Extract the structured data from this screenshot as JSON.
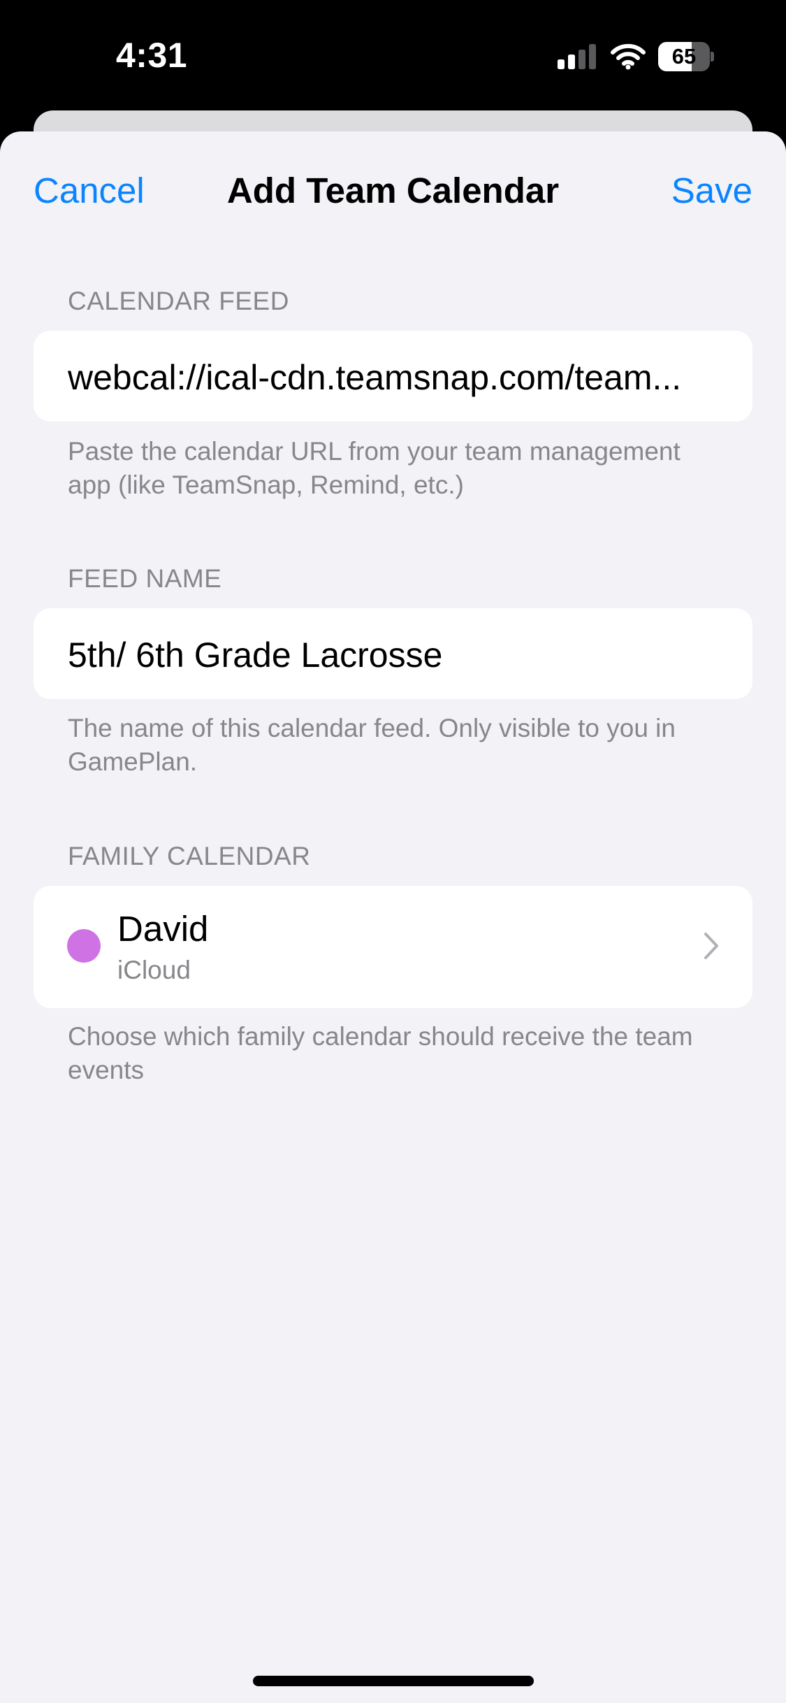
{
  "status_bar": {
    "time": "4:31",
    "battery_level": "65",
    "battery_fraction": 0.65,
    "signal_icon": "cellular-signal-icon",
    "wifi_icon": "wifi-icon"
  },
  "nav": {
    "cancel_label": "Cancel",
    "title": "Add Team Calendar",
    "save_label": "Save"
  },
  "calendar_feed": {
    "header": "CALENDAR FEED",
    "value": "webcal://ical-cdn.teamsnap.com/team...",
    "footer": "Paste the calendar URL from your team management app (like TeamSnap, Remind, etc.)"
  },
  "feed_name": {
    "header": "FEED NAME",
    "value": "5th/ 6th Grade Lacrosse",
    "footer": "The name of this calendar feed. Only visible to you in GamePlan."
  },
  "family_calendar": {
    "header": "FAMILY CALENDAR",
    "name": "David",
    "source": "iCloud",
    "color": "#cf72e4",
    "footer": "Choose which family calendar should receive the team events"
  },
  "colors": {
    "accent": "#0a84ff",
    "background": "#f2f2f7",
    "secondary_text": "#86868b"
  }
}
